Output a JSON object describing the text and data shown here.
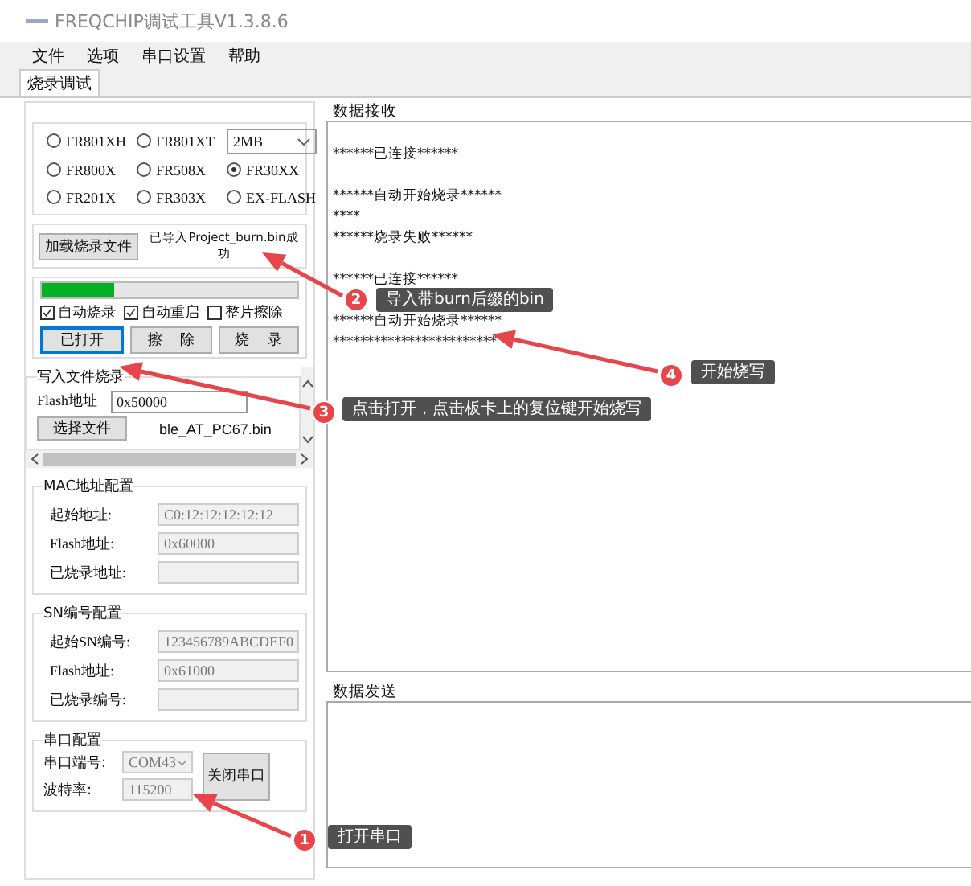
{
  "window": {
    "title": "FREQCHIP调试工具V1.3.8.6"
  },
  "menu": [
    "文件",
    "选项",
    "串口设置",
    "帮助"
  ],
  "tabs": [
    {
      "label": "烧录调试",
      "selected": true
    }
  ],
  "chips": [
    {
      "label": "FR801XH",
      "selected": false
    },
    {
      "label": "FR801XT",
      "selected": false
    },
    {
      "label": "FR800X",
      "selected": false
    },
    {
      "label": "FR508X",
      "selected": false
    },
    {
      "label": "FR30XX",
      "selected": true
    },
    {
      "label": "FR201X",
      "selected": false
    },
    {
      "label": "FR303X",
      "selected": false
    },
    {
      "label": "EX-FLASH",
      "selected": false
    }
  ],
  "flash_size": "2MB",
  "load": {
    "button": "加载烧录文件",
    "status": "已导入Project_burn.bin成功"
  },
  "burn": {
    "level": 0.28,
    "options": [
      {
        "label": "自动烧录",
        "checked": true
      },
      {
        "label": "自动重启",
        "checked": true
      },
      {
        "label": "整片擦除",
        "checked": false
      }
    ],
    "buttons": [
      {
        "label": "已打开",
        "focused": true
      },
      {
        "label": "擦    除",
        "focused": false
      },
      {
        "label": "烧    录",
        "focused": false
      }
    ]
  },
  "file_burn": {
    "legend": "写入文件烧录",
    "address_label": "Flash地址",
    "address": "0x50000",
    "choose_button": "选择文件",
    "file_name": "ble_AT_PC67.bin"
  },
  "groups": [
    {
      "legend": "MAC地址配置",
      "fields": [
        {
          "label": "起始地址:",
          "value": "C0:12:12:12:12:12"
        },
        {
          "label": "Flash地址:",
          "value": "0x60000"
        },
        {
          "label": "已烧录地址:"
        }
      ]
    },
    {
      "legend": "SN编号配置",
      "fields": [
        {
          "label": "起始SN编号:",
          "value": "123456789ABCDEF0"
        },
        {
          "label": "Flash地址:",
          "value": "0x61000"
        },
        {
          "label": "已烧录编号:"
        }
      ]
    }
  ],
  "serial": {
    "legend": "串口配置",
    "port_label": "串口端号:",
    "port": "COM43",
    "baud_label": "波特率:",
    "baud": "115200",
    "button": "关闭串口"
  },
  "receive": {
    "label": "数据接收",
    "lines": [
      {
        "text": "******已连接******",
        "space_before": true
      },
      {
        "text": "******自动开始烧录******",
        "space_before": true
      },
      {
        "text": "****",
        "space_before": false
      },
      {
        "text": "******烧录失败******",
        "space_before": false
      },
      {
        "text": "******已连接******",
        "space_before": true
      },
      {
        "text": "******自动开始烧录******",
        "space_before": true
      },
      {
        "text": "************************",
        "space_before": false
      }
    ]
  },
  "send": {
    "label": "数据发送"
  },
  "callouts": [
    {
      "number": "1",
      "text": "打开串口"
    },
    {
      "number": "2",
      "text": "导入带burn后缀的bin"
    },
    {
      "number": "3",
      "text": "点击打开，点击板卡上的复位键开始烧写"
    },
    {
      "number": "4",
      "text": "开始烧写"
    }
  ]
}
